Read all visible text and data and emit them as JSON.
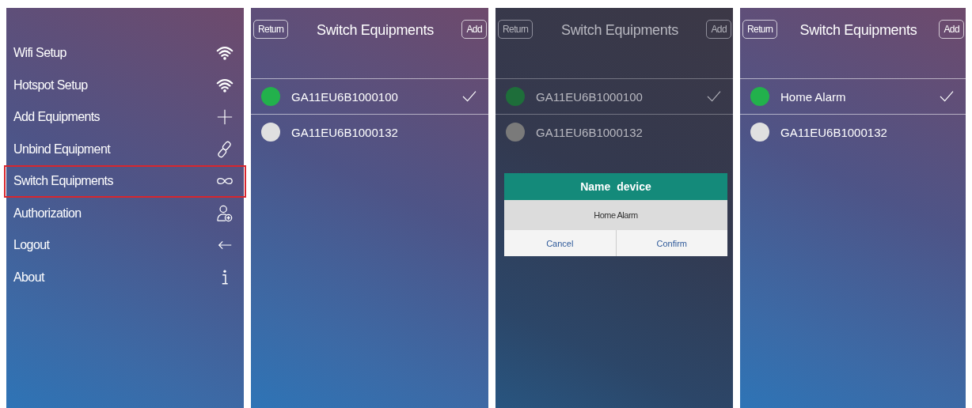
{
  "menu": {
    "items": [
      {
        "label": "Wifi Setup",
        "kind": "wifi",
        "selected": false
      },
      {
        "label": "Hotspot Setup",
        "kind": "wifi",
        "selected": false
      },
      {
        "label": "Add Equipments",
        "kind": "add",
        "selected": false
      },
      {
        "label": "Unbind Equipment",
        "kind": "unbind",
        "selected": false
      },
      {
        "label": "Switch Equipments",
        "kind": "switch",
        "selected": true
      },
      {
        "label": "Authorization",
        "kind": "authorize",
        "selected": false
      },
      {
        "label": "Logout",
        "kind": "logout",
        "selected": false
      },
      {
        "label": "About",
        "kind": "about",
        "selected": false
      }
    ]
  },
  "screens": [
    {
      "return_button": "Return",
      "title": "Switch Equipments",
      "add_button": "Add",
      "dimmed": false,
      "devices": [
        {
          "name": "GA11EU6B1000100",
          "color": "#22b14c",
          "selected": true
        },
        {
          "name": "GA11EU6B1000132",
          "color": "#e0e0e0",
          "selected": false
        }
      ]
    },
    {
      "return_button": "Return",
      "title": "Switch Equipments",
      "add_button": "Add",
      "dimmed": true,
      "devices": [
        {
          "name": "GA11EU6B1000100",
          "color": "#1e6e3a",
          "selected": true
        },
        {
          "name": "GA11EU6B1000132",
          "color": "#7a7a7a",
          "selected": false
        }
      ],
      "dialog": {
        "title": "Name device",
        "value": "Home Alarm",
        "buttons": [
          "Cancel",
          "Confirm"
        ]
      }
    },
    {
      "return_button": "Return",
      "title": "Switch Equipments",
      "add_button": "Add",
      "dimmed": false,
      "devices": [
        {
          "name": "Home Alarm",
          "color": "#22b14c",
          "selected": true
        },
        {
          "name": "GA11EU6B1000132",
          "color": "#e0e0e0",
          "selected": false
        }
      ]
    }
  ]
}
